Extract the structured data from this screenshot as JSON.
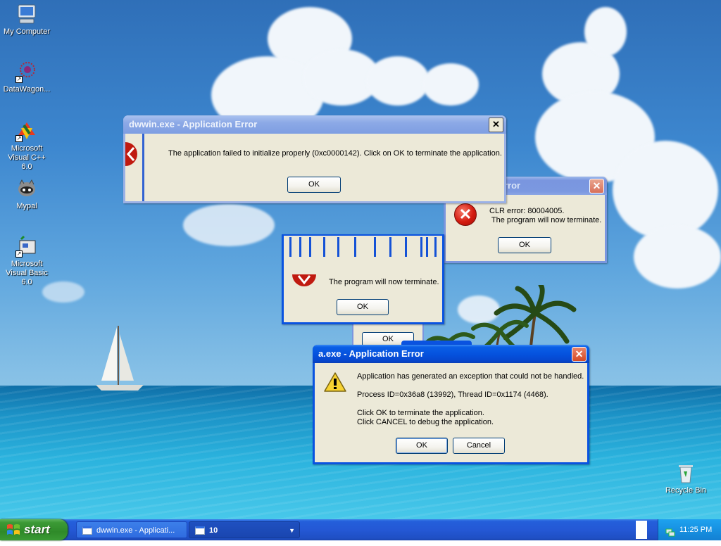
{
  "desktop": {
    "icons": [
      {
        "label": "My Computer"
      },
      {
        "label": "DataWagon..."
      },
      {
        "label": "Microsoft Visual C++ 6.0"
      },
      {
        "label": "Mypal"
      },
      {
        "label": "Microsoft Visual Basic 6.0"
      },
      {
        "label": "Recycle Bin"
      }
    ]
  },
  "dialogs": {
    "dwwin": {
      "title": "dwwin.exe - Application Error",
      "message": "The application failed to initialize properly (0xc0000142). Click on OK to terminate the application.",
      "ok_label": "OK"
    },
    "clr": {
      "title": "rror",
      "message_line1": "CLR error: 80004005.",
      "message_line2": " The program will now terminate.",
      "ok_label": "OK"
    },
    "terminate": {
      "message": "The program will now terminate.",
      "ok_label": "OK"
    },
    "partial": {
      "ok_label": "OK"
    },
    "aexe": {
      "title": "a.exe - Application Error",
      "line1": "Application has generated an exception that could not be handled.",
      "line2": "Process ID=0x36a8 (13992), Thread ID=0x1174 (4468).",
      "line3": "Click OK to terminate the application.",
      "line4": "Click CANCEL to debug the application.",
      "ok_label": "OK",
      "cancel_label": "Cancel"
    }
  },
  "taskbar": {
    "start_label": "start",
    "tasks": [
      {
        "label": "dwwin.exe - Applicati..."
      },
      {
        "label": "10"
      }
    ],
    "clock": "11:25 PM"
  }
}
